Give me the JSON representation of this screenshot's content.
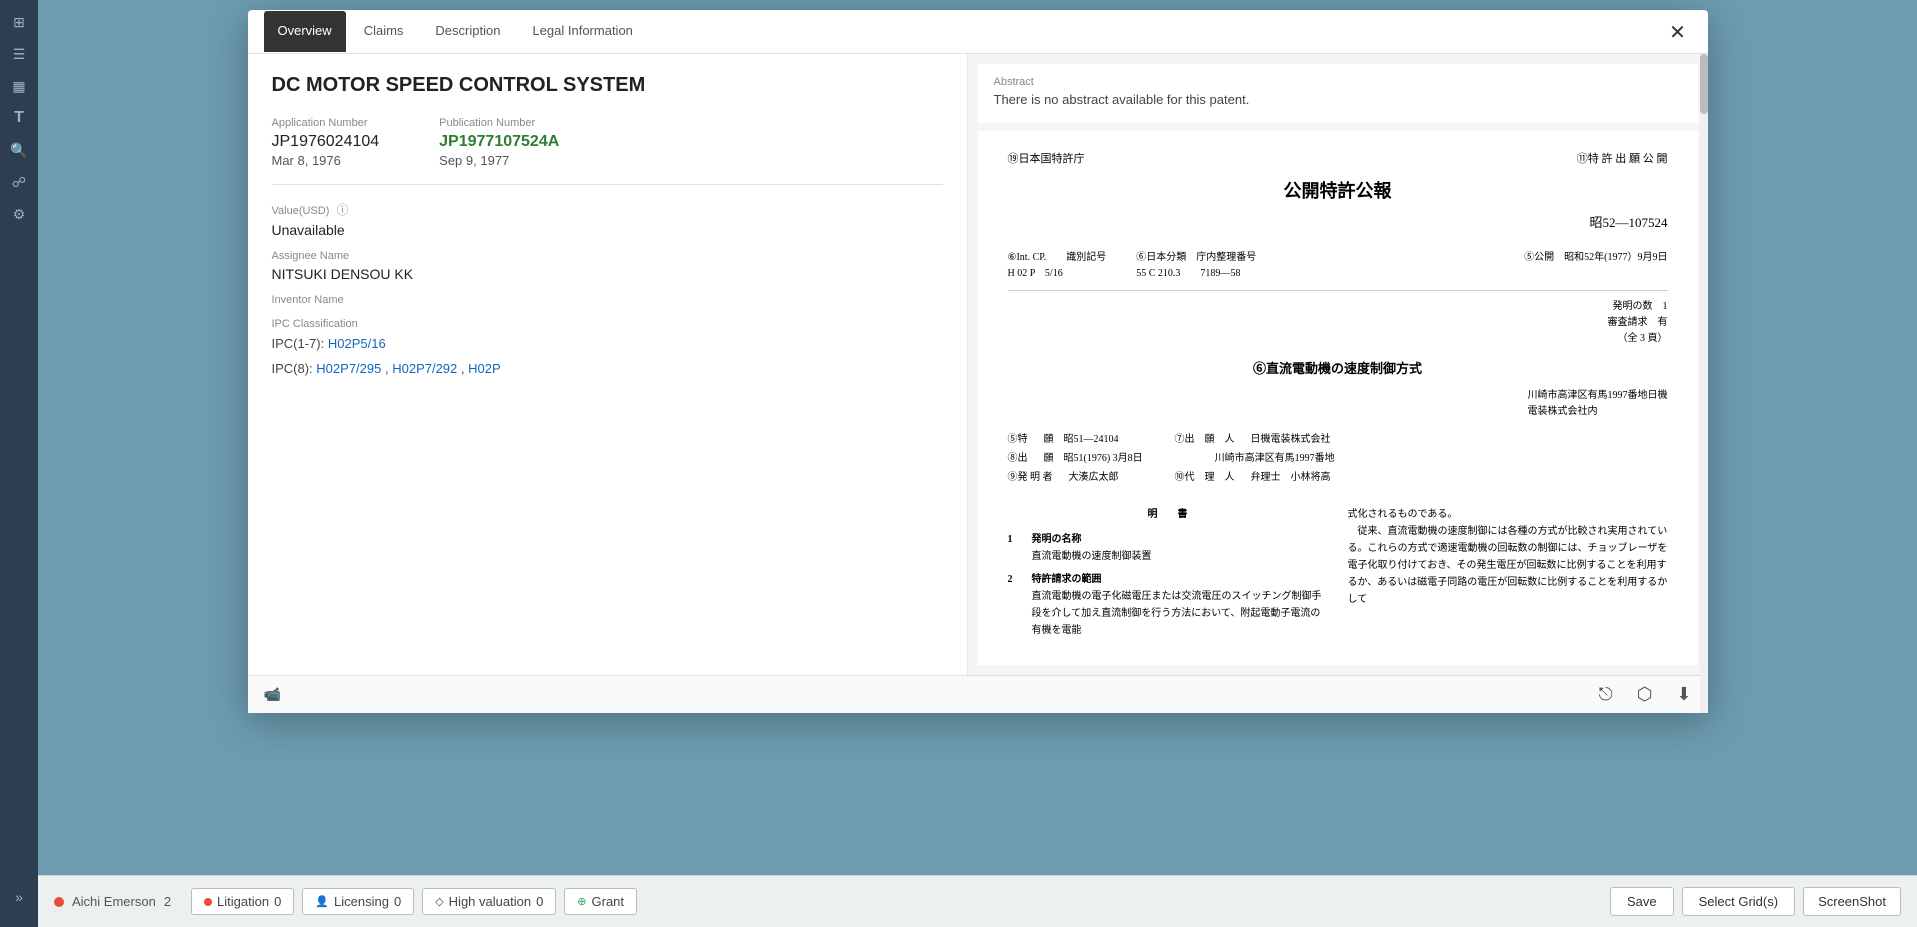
{
  "sidebar": {
    "icons": [
      {
        "name": "grid-icon",
        "symbol": "⊞"
      },
      {
        "name": "list-icon",
        "symbol": "≡"
      },
      {
        "name": "chart-icon",
        "symbol": "▦"
      },
      {
        "name": "text-icon",
        "symbol": "T"
      },
      {
        "name": "search-icon",
        "symbol": "🔍"
      },
      {
        "name": "layers-icon",
        "symbol": "⧉"
      },
      {
        "name": "settings-icon",
        "symbol": "⚙"
      },
      {
        "name": "more-icon",
        "symbol": "»"
      }
    ]
  },
  "modal": {
    "tabs": [
      {
        "label": "Overview",
        "active": true
      },
      {
        "label": "Claims",
        "active": false
      },
      {
        "label": "Description",
        "active": false
      },
      {
        "label": "Legal Information",
        "active": false
      }
    ],
    "close_label": "✕",
    "title": "DC MOTOR SPEED CONTROL SYSTEM",
    "application_number_label": "Application Number",
    "application_number": "JP1976024104",
    "application_date": "Mar 8, 1976",
    "publication_number_label": "Publication Number",
    "publication_number": "JP1977107524A",
    "publication_date": "Sep 9, 1977",
    "value_label": "Value(USD)",
    "value": "Unavailable",
    "assignee_label": "Assignee Name",
    "assignee": "NITSUKI DENSOU KK",
    "inventor_label": "Inventor Name",
    "ipc_label": "IPC Classification",
    "ipc1_label": "IPC(1-7):",
    "ipc1_link": "H02P5/16",
    "ipc8_label": "IPC(8):",
    "ipc8_links": [
      "H02P7/295",
      "H02P7/292",
      "H02P"
    ],
    "abstract_label": "Abstract",
    "abstract_text": "There is no abstract available for this patent.",
    "doc": {
      "header_left": "⑲日本国特許庁",
      "header_right": "⑪特 許 出 願 公 開",
      "main_title": "公開特許公報",
      "number_label": "昭52—107524",
      "meta_row1_left": "⑥Int. CP.　　識別記号",
      "meta_row1_mid": "⑥日本分類　庁内整理番号",
      "meta_row1_right": "⑤公開　昭和52年(1977）9月9日",
      "meta_row2_left": "H 02 P　5/16",
      "meta_row2_mid": "55 C 210.3　　7189—58",
      "doc_info1": "発明の数　1",
      "doc_info2": "審査請求　有",
      "doc_info3": "（全 3 頁）",
      "section_title": "⑥直流電動機の速度制御方式",
      "address_right": "川崎市高津区有馬1997番地日機\n電装株式会社内",
      "table_rows": [
        {
          "col1": "⑤特",
          "col2": "願　昭51—24104",
          "col3": "⑦出　願　人",
          "col4": "日機電装株式会社"
        },
        {
          "col1": "⑧出",
          "col2": "願　昭51(1976) 3月8日",
          "col3": "",
          "col4": "川崎市高津区有馬1997番地"
        },
        {
          "col1": "⑨発 明 者",
          "col2": "大湊広太郎",
          "col3": "⑩代　理　人",
          "col4": "弁理士　小林将高"
        }
      ],
      "body_cols": {
        "left_items": [
          {
            "num": "1",
            "label": "発明の名称",
            "text": "直流電動機の速度制御装置"
          },
          {
            "num": "2",
            "label": "特許請求の範囲",
            "text": "直流電動機の電子化磁電圧または交流電圧のスイッチング制御手段を介して加え直流制御を行う方法において、附起電動子電流の有機を電能"
          }
        ],
        "right_text": "式化されるものである。\n　従来、直流電動機の速度制御には各種の方式が比較され実用されている。これらの方式で適速電動機の回転数の制御には、チョッブレーザを電子化取り付けておき、その発生電圧が回転数に比例することを利用するか、あるいは磁電子同路の電圧が回転数に比例することを利用するかして"
      }
    }
  },
  "footer": {
    "camera_icon": "📷",
    "box_icon": "⬡",
    "download_icon": "⬇"
  },
  "bottom_bar": {
    "litigation_label": "Litigation",
    "litigation_count": "0",
    "licensing_label": "Licensing",
    "licensing_count": "0",
    "high_valuation_label": "High valuation",
    "high_valuation_count": "0",
    "grant_label": "Grant",
    "save_label": "Save",
    "select_grids_label": "Select Grid(s)",
    "screenshot_label": "ScreenShot",
    "assignee_tag": "Aichi Emerson",
    "assignee_count": "2"
  }
}
